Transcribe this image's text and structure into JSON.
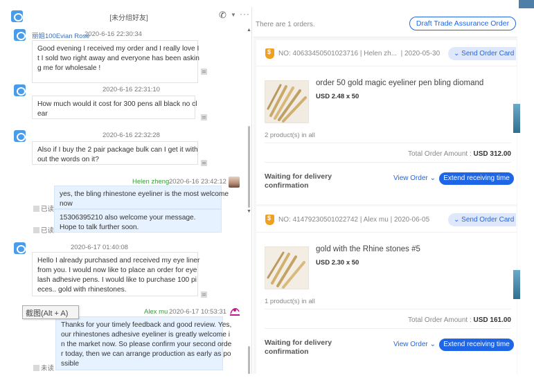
{
  "chat": {
    "title": "[未分组好友]",
    "messages": [
      {
        "sender": "丽姐100Evian Rose",
        "time": "2020-6-16 22:30:34",
        "lines": [
          "Good evening I received my order and I really love I",
          "t I sold two right away and everyone has been askin",
          "g me for wholesale !"
        ]
      },
      {
        "sender": "",
        "time": "2020-6-16 22:31:10",
        "lines": [
          "How much would it cost for 300 pens all black no cl",
          "ear"
        ]
      },
      {
        "sender": "",
        "time": "2020-6-16 22:32:28",
        "lines": [
          "Also if I buy the 2 pair package bulk can I get it with",
          "out the words on it?"
        ]
      },
      {
        "sender": "Helen zheng",
        "time": "2020-6-16 23:42:12",
        "status": "已读",
        "lines": [
          "yes, the bling rhinestone eyeliner is the most welcome",
          "now"
        ]
      },
      {
        "sender": "",
        "time": "",
        "status": "已读",
        "lines": [
          "15306395210 also welcome your message.",
          "Hope to talk further soon."
        ]
      },
      {
        "sender": "",
        "time": "2020-6-17 01:40:08",
        "lines": [
          "Hello I already purchased and received my eye liner",
          "from you. I would now like to place an order for eye",
          " lash adhesive pens. I would like to purchase 100 pi",
          "eces.. gold with rhinestones."
        ]
      },
      {
        "sender": "Alex mu",
        "time": "2020-6-17 10:53:31",
        "status": "未读",
        "lines": [
          "Thanks for your timely feedback and good review. Yes,",
          " our rhinestones adhesive eyeliner is greatly welcome i",
          "n the market now. So please confirm your second orde",
          "r today, then we can arrange production as early as po",
          "ssible"
        ]
      }
    ],
    "tooltip": "截图(Alt + A)"
  },
  "orders": {
    "count_text": "There are 1 orders.",
    "draft_button": "Draft Trade Assurance Order",
    "cards": [
      {
        "meta": "NO: 40633450501023716 | Helen zh...  | 2020-05-30",
        "send_button": "Send Order Card",
        "product_name": "order 50 gold magic eyeliner pen bling diomand",
        "price": "USD 2.48 x 50",
        "product_count": "2 product(s) in all",
        "total_label": "Total Order Amount :",
        "total_value": "USD 312.00",
        "status_lines": [
          "Waiting for delivery",
          "confirmation"
        ],
        "view_order": "View Order",
        "extend_button": "Extend receiving time"
      },
      {
        "meta": "NO: 41479230501022742 | Alex mu | 2020-06-05",
        "send_button": "Send Order Card",
        "product_name": "gold with the Rhine stones #5",
        "price": "USD 2.30 x 50",
        "product_count": "1 product(s) in all",
        "total_label": "Total Order Amount :",
        "total_value": "USD 161.00",
        "status_lines": [
          "Waiting for delivery",
          "confirmation"
        ],
        "view_order": "View Order",
        "extend_button": "Extend receiving time"
      }
    ]
  },
  "colors": {
    "accent": "#1e66e6",
    "bubble_out": "#e6f2ff",
    "shield": "#f0a020"
  },
  "icons": [
    "chat-logo-icon",
    "phone-icon",
    "more-icon",
    "shield-icon",
    "chevron-down-icon"
  ]
}
